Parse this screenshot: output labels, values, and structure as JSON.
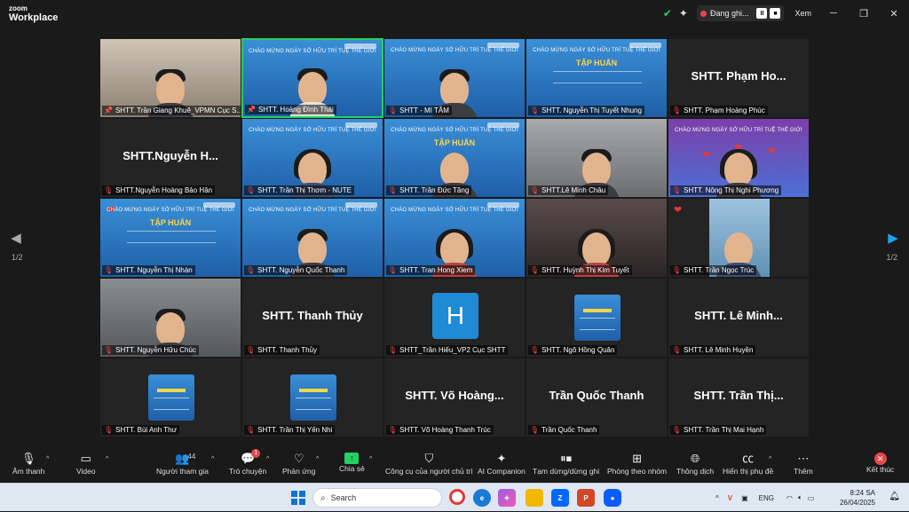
{
  "app": {
    "logo_line1": "zoom",
    "logo_line2": "Workplace"
  },
  "topbar": {
    "recording_label": "Đang ghi...",
    "view_label": "Xem",
    "pause_symbol": "II",
    "stop_symbol": "■",
    "icons": [
      "shield-check-icon",
      "sparkle-icon",
      "minimize-icon",
      "restore-icon",
      "close-icon"
    ]
  },
  "gallery": {
    "page_indicator_left": "1/2",
    "page_indicator_right": "1/2",
    "slide_banner": "CHÀO MỪNG NGÀY SỞ HỮU TRÍ TUỆ THẾ GIỚI",
    "slide_heading": "TẬP HUẤN",
    "tiles": [
      {
        "name": "SHTT. Trần Giang Khuê_VPMN Cục S...",
        "muted": false,
        "pinned": true,
        "big_name": ""
      },
      {
        "name": "SHTT. Hoàng Đình Thái",
        "muted": false,
        "pinned": true,
        "big_name": ""
      },
      {
        "name": "SHTT - MI TÂM",
        "muted": true,
        "pinned": false,
        "big_name": ""
      },
      {
        "name": "SHTT. Nguyễn Thị Tuyết Nhung",
        "muted": true,
        "pinned": false,
        "big_name": ""
      },
      {
        "name": "SHTT. Phạm Hoàng Phúc",
        "muted": true,
        "pinned": false,
        "big_name": "SHTT. Phạm Ho..."
      },
      {
        "name": "SHTT.Nguyễn Hoàng Bảo Hân",
        "muted": true,
        "pinned": false,
        "big_name": "SHTT.Nguyễn H..."
      },
      {
        "name": "SHTT. Trần Thị Thơm - NUTE",
        "muted": true,
        "pinned": false,
        "big_name": ""
      },
      {
        "name": "SHTT. Trần Đức Tăng",
        "muted": true,
        "pinned": false,
        "big_name": ""
      },
      {
        "name": "SHTT.Lê Minh Châu",
        "muted": true,
        "pinned": false,
        "big_name": ""
      },
      {
        "name": "SHTT. Nông Thị Nghi Phương",
        "muted": true,
        "pinned": false,
        "big_name": ""
      },
      {
        "name": "SHTT. Nguyễn Thị Nhàn",
        "muted": true,
        "pinned": false,
        "big_name": ""
      },
      {
        "name": "SHTT. Nguyễn Quốc Thanh",
        "muted": true,
        "pinned": false,
        "big_name": ""
      },
      {
        "name": "SHTT. Tran Hong Xiem",
        "muted": true,
        "pinned": false,
        "big_name": ""
      },
      {
        "name": "SHTT. Huỳnh Thị Kim Tuyết",
        "muted": true,
        "pinned": false,
        "big_name": ""
      },
      {
        "name": "SHTT. Trần Ngọc Trúc",
        "muted": true,
        "pinned": false,
        "big_name": ""
      },
      {
        "name": "SHTT. Nguyễn Hữu Chúc",
        "muted": true,
        "pinned": false,
        "big_name": ""
      },
      {
        "name": "SHTT. Thanh Thủy",
        "muted": true,
        "pinned": false,
        "big_name": "SHTT. Thanh Thủy"
      },
      {
        "name": "SHTT_Trần Hiếu_VP2 Cục SHTT",
        "muted": true,
        "pinned": false,
        "big_name": "",
        "avatar_letter": "H"
      },
      {
        "name": "SHTT. Ngô Hồng Quân",
        "muted": true,
        "pinned": false,
        "big_name": ""
      },
      {
        "name": "SHTT. Lê Minh Huyền",
        "muted": true,
        "pinned": false,
        "big_name": "SHTT. Lê Minh..."
      },
      {
        "name": "SHTT. Bùi Anh Thư",
        "muted": true,
        "pinned": false,
        "big_name": ""
      },
      {
        "name": "SHTT. Trần Thị Yến Nhi",
        "muted": true,
        "pinned": false,
        "big_name": ""
      },
      {
        "name": "SHTT. Võ Hoàng Thanh Trúc",
        "muted": true,
        "pinned": false,
        "big_name": "SHTT. Võ Hoàng..."
      },
      {
        "name": "Trần Quốc Thanh",
        "muted": true,
        "pinned": false,
        "big_name": "Trần Quốc Thanh"
      },
      {
        "name": "SHTT. Trần Thị Mai Hạnh",
        "muted": true,
        "pinned": false,
        "big_name": "SHTT. Trần Thị..."
      }
    ]
  },
  "toolbar": {
    "mic": "Âm thanh",
    "video": "Video",
    "participants": "Người tham gia",
    "participants_count": "44",
    "chat": "Trò chuyện",
    "chat_badge": "1",
    "react": "Phản ứng",
    "share": "Chia sẻ",
    "host_tools": "Công cụ của người chủ trì",
    "ai": "AI Companion",
    "pause_rec": "Tạm dừng/dừng ghi",
    "rooms": "Phòng theo nhóm",
    "translate": "Thông dịch",
    "captions": "Hiển thị phụ đề",
    "more": "Thêm",
    "end": "Kết thúc"
  },
  "taskbar": {
    "search_placeholder": "Search",
    "lang": "ENG",
    "time": "8:24 SA",
    "date": "26/04/2025"
  },
  "colors": {
    "accent_green": "#23d160",
    "mute_red": "#e5484d",
    "zoom_blue": "#1da1f2"
  }
}
